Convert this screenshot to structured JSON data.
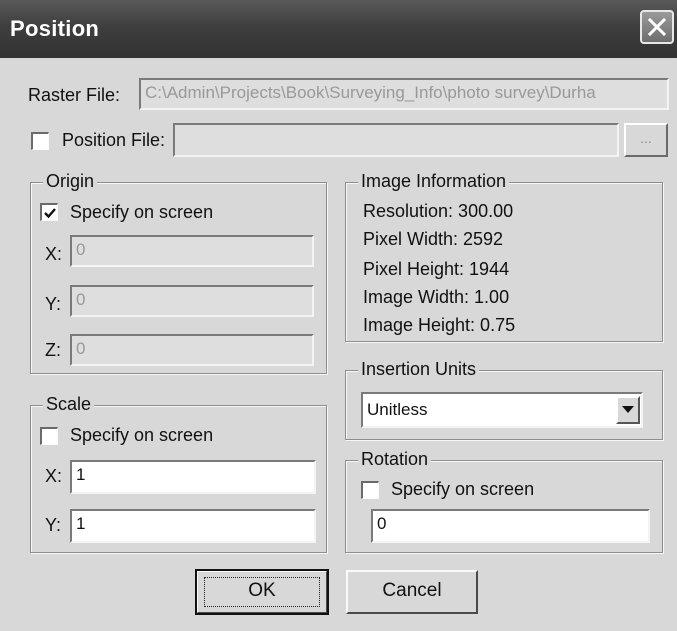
{
  "window": {
    "title": "Position"
  },
  "raster_file": {
    "label": "Raster File:",
    "value": "C:\\Admin\\Projects\\Book\\Surveying_Info\\photo survey\\Durha"
  },
  "position_file": {
    "label": "Position File:",
    "checked": false,
    "value": "",
    "browse_label": "..."
  },
  "origin": {
    "title": "Origin",
    "specify_label": "Specify on screen",
    "specify_checked": true,
    "x_label": "X:",
    "x_value": "0",
    "y_label": "Y:",
    "y_value": "0",
    "z_label": "Z:",
    "z_value": "0"
  },
  "image_information": {
    "title": "Image Information",
    "resolution": "Resolution:  300.00",
    "pixel_width": "Pixel Width:  2592",
    "pixel_height": "Pixel Height:  1944",
    "image_width": "Image Width:  1.00",
    "image_height": "Image Height:  0.75"
  },
  "insertion_units": {
    "title": "Insertion Units",
    "selected": "Unitless"
  },
  "scale": {
    "title": "Scale",
    "specify_label": "Specify on screen",
    "specify_checked": false,
    "x_label": "X:",
    "x_value": "1",
    "y_label": "Y:",
    "y_value": "1"
  },
  "rotation": {
    "title": "Rotation",
    "specify_label": "Specify on screen",
    "specify_checked": false,
    "value": "0"
  },
  "buttons": {
    "ok": "OK",
    "cancel": "Cancel"
  },
  "colors": {
    "titlebar": "#3e3e3e",
    "dialog_bg": "#d8d8d8",
    "field_disabled": "#dedede",
    "field_enabled": "#ffffff"
  }
}
